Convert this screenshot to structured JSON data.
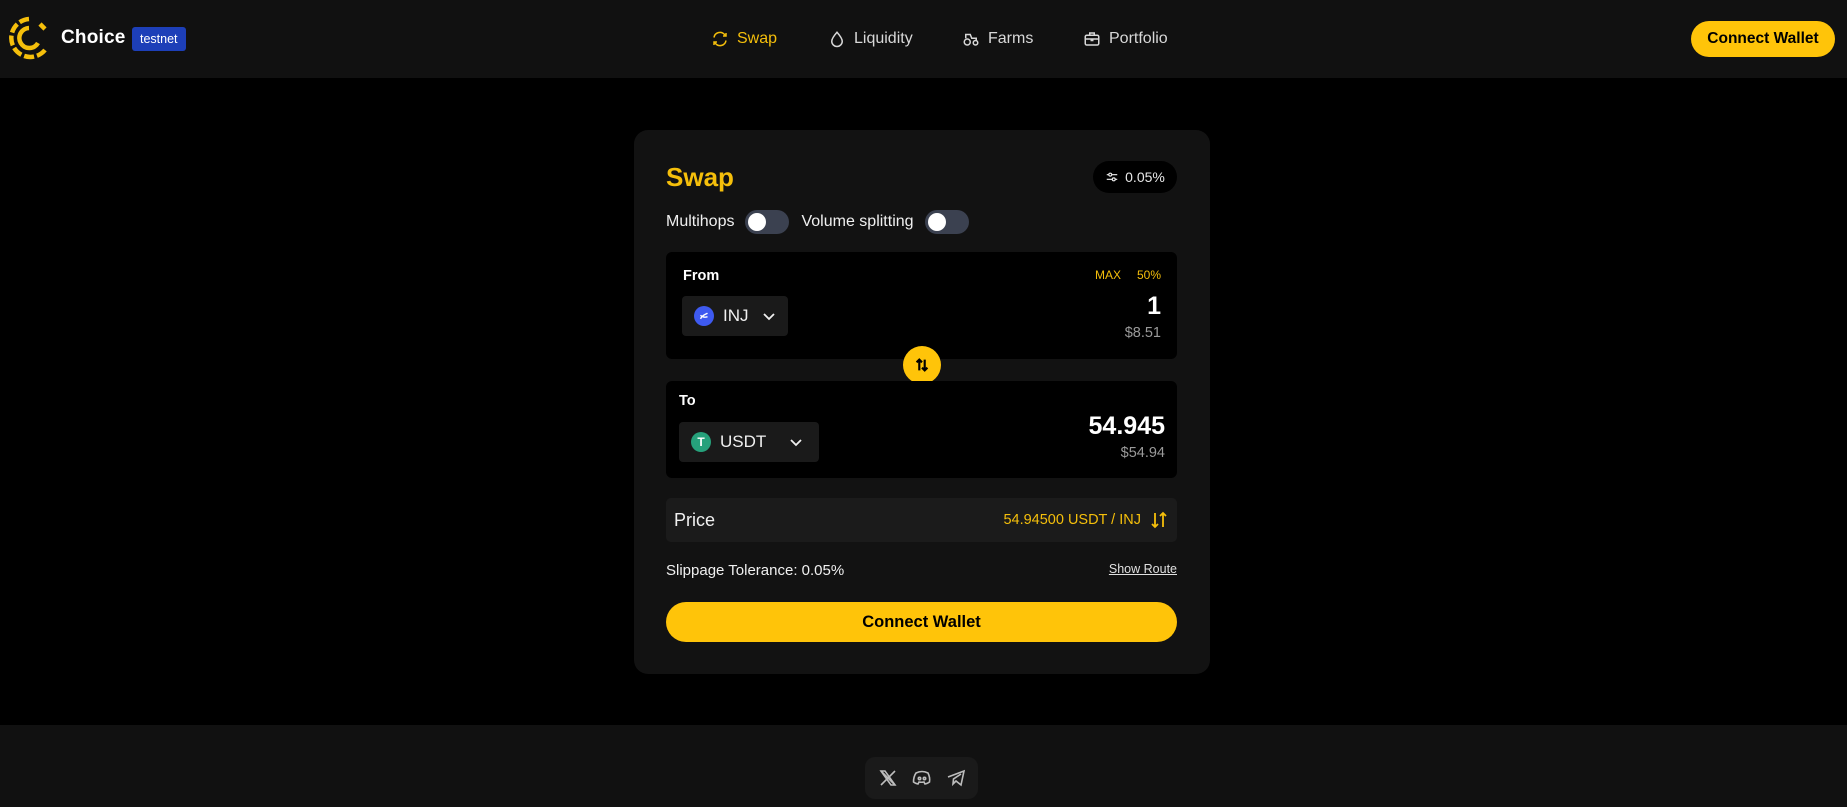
{
  "header": {
    "brand": "Choice",
    "badge": "testnet",
    "nav": [
      {
        "label": "Swap",
        "icon": "refresh-icon",
        "active": true
      },
      {
        "label": "Liquidity",
        "icon": "droplet-icon",
        "active": false
      },
      {
        "label": "Farms",
        "icon": "tractor-icon",
        "active": false
      },
      {
        "label": "Portfolio",
        "icon": "briefcase-icon",
        "active": false
      }
    ],
    "connect_label": "Connect Wallet"
  },
  "swap": {
    "title": "Swap",
    "slippage_chip": "0.05%",
    "multihops_label": "Multihops",
    "multihops_on": false,
    "volume_label": "Volume splitting",
    "volume_on": false,
    "from": {
      "label": "From",
      "token": "INJ",
      "max_label": "MAX",
      "half_label": "50%",
      "amount": "1",
      "usd": "$8.51"
    },
    "to": {
      "label": "To",
      "token": "USDT",
      "amount": "54.945",
      "usd": "$54.94"
    },
    "price_label": "Price",
    "price_value": "54.94500 USDT / INJ",
    "slippage_text": "Slippage Tolerance: 0.05%",
    "show_route": "Show Route",
    "connect_label": "Connect Wallet"
  },
  "colors": {
    "accent": "#ffc409",
    "accent_text": "#f5bf0b",
    "badge": "#1d3fb8",
    "inj": "#3e5af0",
    "usdt": "#26a17b"
  },
  "footer": {
    "socials": [
      "x-icon",
      "discord-icon",
      "telegram-icon"
    ]
  }
}
